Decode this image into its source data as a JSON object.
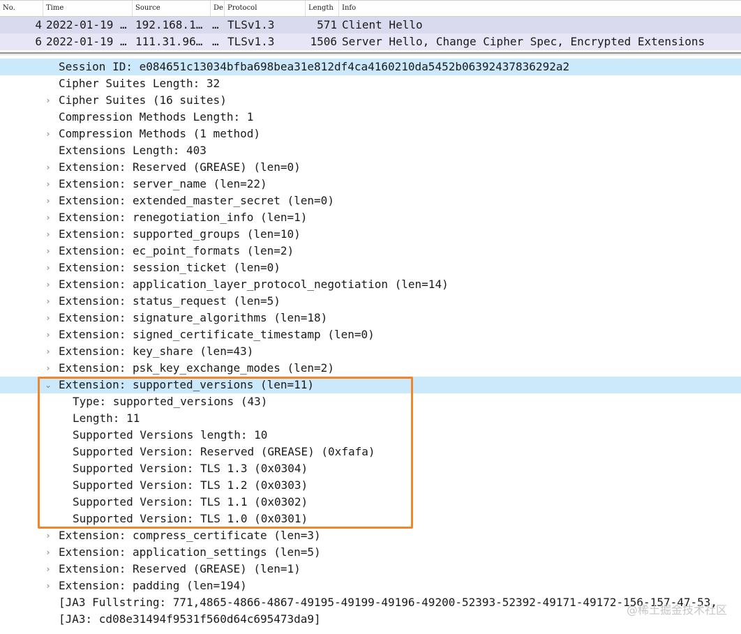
{
  "packet_list": {
    "columns": {
      "no": "No.",
      "time": "Time",
      "source": "Source",
      "destination": "De",
      "protocol": "Protocol",
      "length": "Length",
      "info": "Info"
    },
    "rows": [
      {
        "no": "4",
        "time": "2022-01-19 …",
        "source": "192.168.1…",
        "destination": "…",
        "protocol": "TLSv1.3",
        "length": "571",
        "info": "Client Hello"
      },
      {
        "no": "6",
        "time": "2022-01-19 …",
        "source": "111.31.96…",
        "destination": "…",
        "protocol": "TLSv1.3",
        "length": "1506",
        "info": "Server Hello, Change Cipher Spec, Encrypted Extensions"
      }
    ]
  },
  "details": {
    "lines": [
      "Session ID: e084651c13034bfba698bea31e812df4ca4160210da5452b06392437836292a2",
      "Cipher Suites Length: 32",
      "Cipher Suites (16 suites)",
      "Compression Methods Length: 1",
      "Compression Methods (1 method)",
      "Extensions Length: 403",
      "Extension: Reserved (GREASE) (len=0)",
      "Extension: server_name (len=22)",
      "Extension: extended_master_secret (len=0)",
      "Extension: renegotiation_info (len=1)",
      "Extension: supported_groups (len=10)",
      "Extension: ec_point_formats (len=2)",
      "Extension: session_ticket (len=0)",
      "Extension: application_layer_protocol_negotiation (len=14)",
      "Extension: status_request (len=5)",
      "Extension: signature_algorithms (len=18)",
      "Extension: signed_certificate_timestamp (len=0)",
      "Extension: key_share (len=43)",
      "Extension: psk_key_exchange_modes (len=2)",
      "Extension: supported_versions (len=11)",
      "Type: supported_versions (43)",
      "Length: 11",
      "Supported Versions length: 10",
      "Supported Version: Reserved (GREASE) (0xfafa)",
      "Supported Version: TLS 1.3 (0x0304)",
      "Supported Version: TLS 1.2 (0x0303)",
      "Supported Version: TLS 1.1 (0x0302)",
      "Supported Version: TLS 1.0 (0x0301)",
      "Extension: compress_certificate (len=3)",
      "Extension: application_settings (len=5)",
      "Extension: Reserved (GREASE) (len=1)",
      "Extension: padding (len=194)",
      "[JA3 Fullstring: 771,4865-4866-4867-49195-49199-49196-49200-52393-52392-49171-49172-156-157-47-53,",
      "[JA3: cd08e31494f9531f560d64c695473da9]"
    ]
  },
  "watermark": "@稀土掘金技术社区",
  "colors": {
    "selected_row": "#cce8fb",
    "packet_row_bg": "#dadaee",
    "highlight_box": "#f0862c"
  }
}
